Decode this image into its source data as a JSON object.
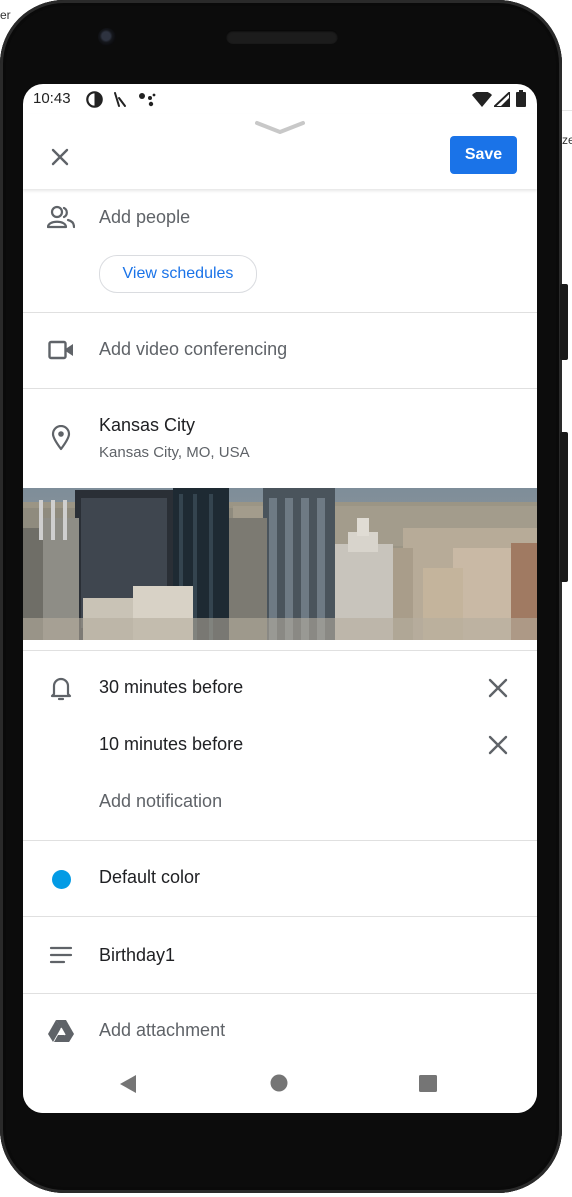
{
  "background": {
    "left_fragment": "er",
    "right_fragment": "ze"
  },
  "status_bar": {
    "time": "10:43",
    "left_icons": [
      "data-saver-icon",
      "missed-call-icon",
      "assistant-dots-icon"
    ],
    "right_icons": [
      "wifi-icon",
      "signal-icon",
      "battery-icon"
    ]
  },
  "toolbar": {
    "save_label": "Save",
    "close_icon": "close-icon"
  },
  "event": {
    "add_people_label": "Add people",
    "view_schedules_label": "View schedules",
    "video_label": "Add video conferencing",
    "location": {
      "name": "Kansas City",
      "address": "Kansas City, MO, USA"
    },
    "notifications": [
      {
        "label": "30 minutes before"
      },
      {
        "label": "10 minutes before"
      }
    ],
    "add_notification_label": "Add notification",
    "color": {
      "label": "Default color",
      "value": "#039be5"
    },
    "description": "Birthday1",
    "attachment_label": "Add attachment"
  },
  "nav": {
    "back": "back-icon",
    "home": "home-icon",
    "recents": "recents-icon"
  },
  "colors": {
    "accent": "#1a73e8",
    "text": "#202124",
    "muted": "#5f6368",
    "divider": "#e0e0e0"
  }
}
